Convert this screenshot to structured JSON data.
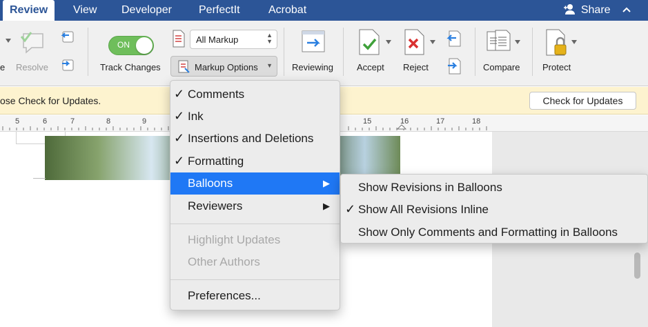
{
  "tabs": [
    {
      "label": "Review",
      "active": true
    },
    {
      "label": "View"
    },
    {
      "label": "Developer"
    },
    {
      "label": "PerfectIt"
    },
    {
      "label": "Acrobat"
    }
  ],
  "share": {
    "label": "Share",
    "icon": "add-person-icon",
    "collapse_icon": "chevron-up-icon"
  },
  "ribbon": {
    "partial_label": "e",
    "resolve_label": "Resolve",
    "toggle_label": "ON",
    "track_changes_label": "Track Changes",
    "display_for_review_value": "All Markup",
    "markup_options_label": "Markup Options",
    "reviewing_label": "Reviewing",
    "accept_label": "Accept",
    "reject_label": "Reject",
    "compare_label": "Compare",
    "protect_label": "Protect"
  },
  "notification": {
    "message": "ose Check for Updates.",
    "button": "Check for Updates"
  },
  "ruler": {
    "labels": [
      "5",
      "6",
      "7",
      "8",
      "9",
      "15",
      "16",
      "17",
      "18"
    ]
  },
  "markup_menu": {
    "items": [
      {
        "label": "Comments",
        "check": "✓"
      },
      {
        "label": "Ink",
        "check": "✓"
      },
      {
        "label": "Insertions and Deletions",
        "check": "✓"
      },
      {
        "label": "Formatting",
        "check": "✓"
      },
      {
        "label": "Balloons",
        "arrow": "▶"
      },
      {
        "label": "Reviewers",
        "arrow": "▶"
      },
      {
        "label": "Highlight Updates"
      },
      {
        "label": "Other Authors"
      },
      {
        "label": "Preferences..."
      }
    ]
  },
  "balloons_submenu": {
    "items": [
      {
        "label": "Show Revisions in Balloons"
      },
      {
        "label": "Show All Revisions Inline",
        "check": "✓"
      },
      {
        "label": "Show Only Comments and Formatting in Balloons"
      }
    ]
  },
  "colors": {
    "accent": "#2c5597",
    "highlight": "#1f78f5",
    "toggle_on": "#6fbe5b",
    "notification_bg": "#fdf3cf"
  }
}
